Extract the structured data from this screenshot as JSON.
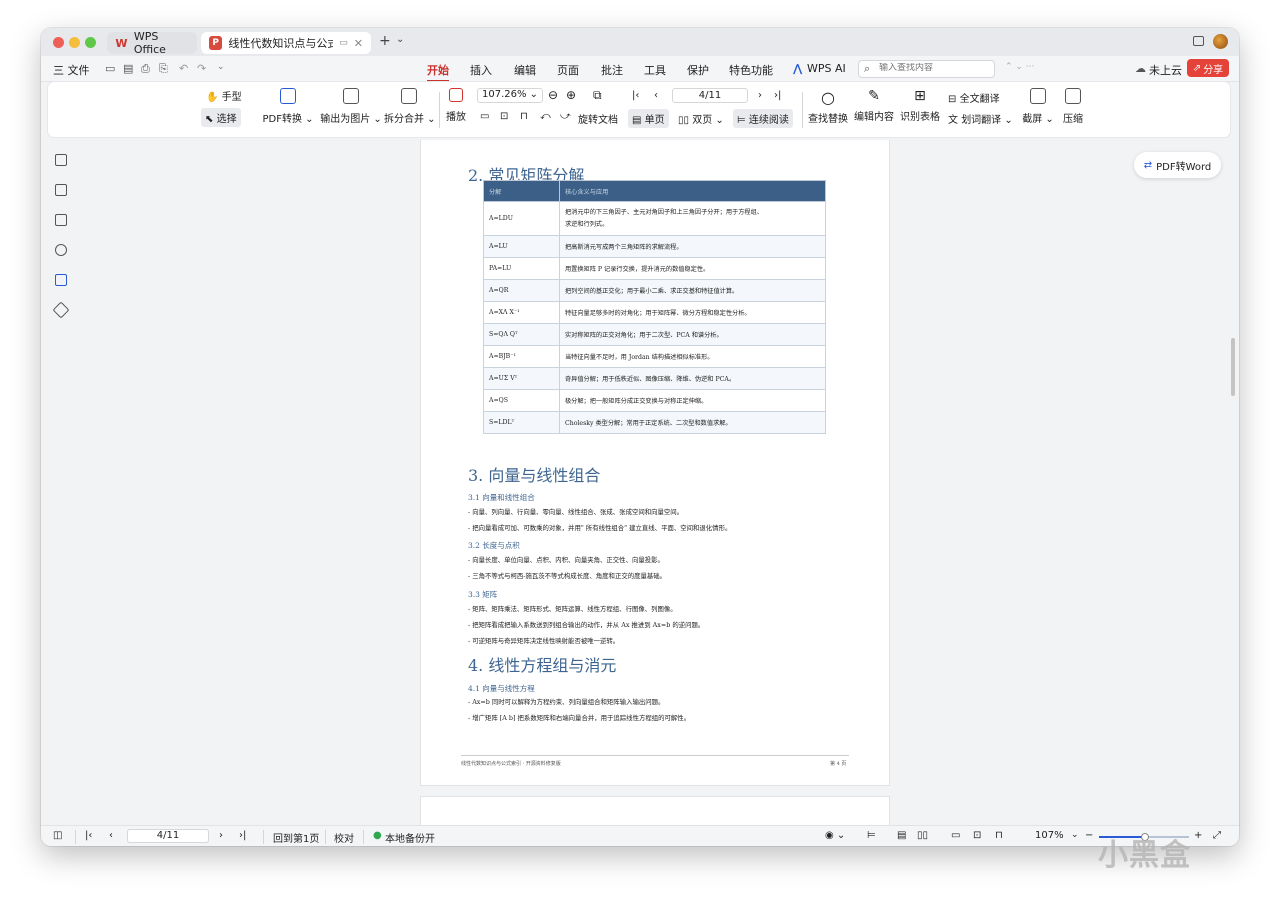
{
  "titlebar": {
    "tabs": [
      {
        "label": "WPS Office"
      },
      {
        "label": "线性代数知识点与公式索引"
      }
    ],
    "new_tab": "+",
    "tab_menu": "⌄"
  },
  "menubar": {
    "file": "三 文件",
    "items": [
      "开始",
      "插入",
      "编辑",
      "页面",
      "批注",
      "工具",
      "保护",
      "特色功能"
    ],
    "wps_ai": "WPS AI",
    "search_placeholder": "输入查找内容",
    "cloud": "未上云",
    "share": "分享"
  },
  "ribbon": {
    "hand": "手型",
    "select": "选择",
    "pdf_convert": "PDF转换",
    "export_image": "输出为图片",
    "split_merge": "拆分合并",
    "play": "播放",
    "zoom": "107.26%",
    "page_input": "4/11",
    "rotate": "旋转文档",
    "single": "单页",
    "double": "双页",
    "continuous": "连续阅读",
    "find_replace": "查找替换",
    "edit_content": "编辑内容",
    "recognize_table": "识别表格",
    "full_translate": "全文翻译",
    "word_translate": "划词翻译",
    "screenshot": "截屏",
    "compress": "压缩"
  },
  "float": {
    "pdf_to_word": "PDF转Word"
  },
  "doc": {
    "sec2_title": "2. 常见矩阵分解",
    "table_headers": [
      "分解",
      "核心含义与应用"
    ],
    "table_rows": [
      [
        "A=LDU",
        "把消元中的下三角因子、主元对角因子和上三角因子分开；用于方程组、",
        "求逆和行列式。"
      ],
      [
        "A=LU",
        "把高斯消元写成两个三角矩阵的求解流程。",
        ""
      ],
      [
        "PA=LU",
        "用置换矩阵 P 记录行交换，提升消元的数值稳定性。",
        ""
      ],
      [
        "A=QR",
        "把列空间的基正交化；用于最小二乘、求正交基和特征值计算。",
        ""
      ],
      [
        "A=XΛ X⁻¹",
        "特征向量足够多时的对角化；用于矩阵幂、微分方程和稳定性分析。",
        ""
      ],
      [
        "S=QΛ Qᵀ",
        "实对称矩阵的正交对角化；用于二次型、PCA 和谱分析。",
        ""
      ],
      [
        "A=BJB⁻¹",
        "当特征向量不足时，用 Jordan 结构描述相似标准形。",
        ""
      ],
      [
        "A=UΣ Vᵀ",
        "奇异值分解；用于低秩近似、图像压缩、降维、伪逆和 PCA。",
        ""
      ],
      [
        "A=QS",
        "极分解；把一般矩阵分成正交变换与对称正定伸缩。",
        ""
      ],
      [
        "S=LDLᵀ",
        "Cholesky 类型分解；常用于正定系统、二次型和数值求解。",
        ""
      ]
    ],
    "sec3_title": "3. 向量与线性组合",
    "s31": "3.1 向量和线性组合",
    "s31_l1": "- 向量、列向量、行向量、零向量、线性组合、张成、张成空间和向量空间。",
    "s31_l2": "- 把向量看成可加、可数乘的对象，并用\" 所有线性组合\" 建立直线、平面、空间和退化情形。",
    "s32": "3.2 长度与点积",
    "s32_l1": "- 向量长度、单位向量、点积、内积、向量夹角、正交性、向量投影。",
    "s32_l2": "- 三角不等式与柯西-施瓦茨不等式构成长度、角度和正交的度量基础。",
    "s33": "3.3 矩阵",
    "s33_l1": "- 矩阵、矩阵乘法、矩阵形式、矩阵运算、线性方程组、行图像、列图像。",
    "s33_l2": "- 把矩阵看成把输入系数送到列组合输出的动作，并从 Ax 推进到 Ax=b 的逆问题。",
    "s33_l3": "- 可逆矩阵与奇异矩阵决定线性映射能否被唯一逆转。",
    "sec4_title": "4. 线性方程组与消元",
    "s41": "4.1 向量与线性方程",
    "s41_l1": "- Ax=b 同时可以解释为方程约束、列向量组合和矩阵输入输出问题。",
    "s41_l2": "- 增广矩阵 [A b] 把系数矩阵和右端向量合并，用于追踪线性方程组的可解性。",
    "footer_left": "线性代数知识点与公式索引 · 开源资料修复版",
    "footer_right": "第 4 页"
  },
  "status": {
    "page": "4/11",
    "back_first": "回到第1页",
    "proofread": "校对",
    "backup": "本地备份开",
    "zoom": "107%"
  },
  "watermark": "小黑盒"
}
